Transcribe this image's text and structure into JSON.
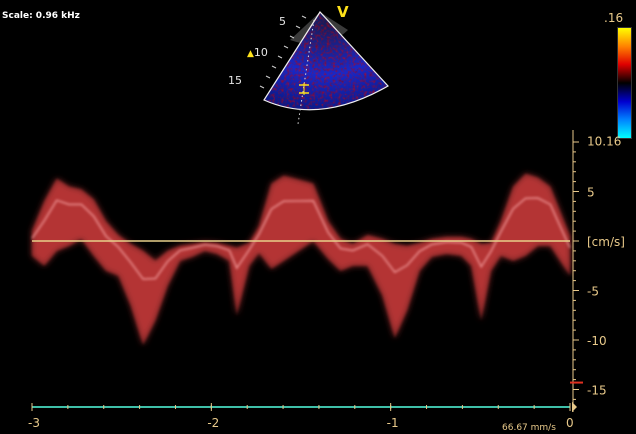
{
  "header": {
    "scale_label": "Scale: 0.96 kHz"
  },
  "sector": {
    "depth_labels": [
      "5",
      "10",
      "15"
    ],
    "view_marker": "V",
    "focus_icon": "triangle-focus-icon",
    "gate_icon": "sample-gate-icon"
  },
  "color_scale": {
    "top_label": ".16",
    "bottom_label": "",
    "colors": [
      "#ffff00",
      "#ff8000",
      "#e00000",
      "#000000",
      "#0000d0",
      "#0080ff",
      "#00ffff"
    ]
  },
  "velocity_axis": {
    "unit": "[cm/s]",
    "top_value": "10.16",
    "ticks": [
      "5",
      "0",
      "-5",
      "-10",
      "-15"
    ],
    "range": [
      -16,
      10.16
    ]
  },
  "time_axis": {
    "labels": [
      "-3",
      "-2",
      "-1",
      "0"
    ],
    "range": [
      -3,
      0
    ],
    "sweep_speed": "66.67 mm/s"
  },
  "colors": {
    "baseline": "#e8d08a",
    "spectrum": "#ff4a4a",
    "axis": "#e8c98a",
    "time_bar": "#3fbfa8",
    "marker_red": "#e03020"
  }
}
